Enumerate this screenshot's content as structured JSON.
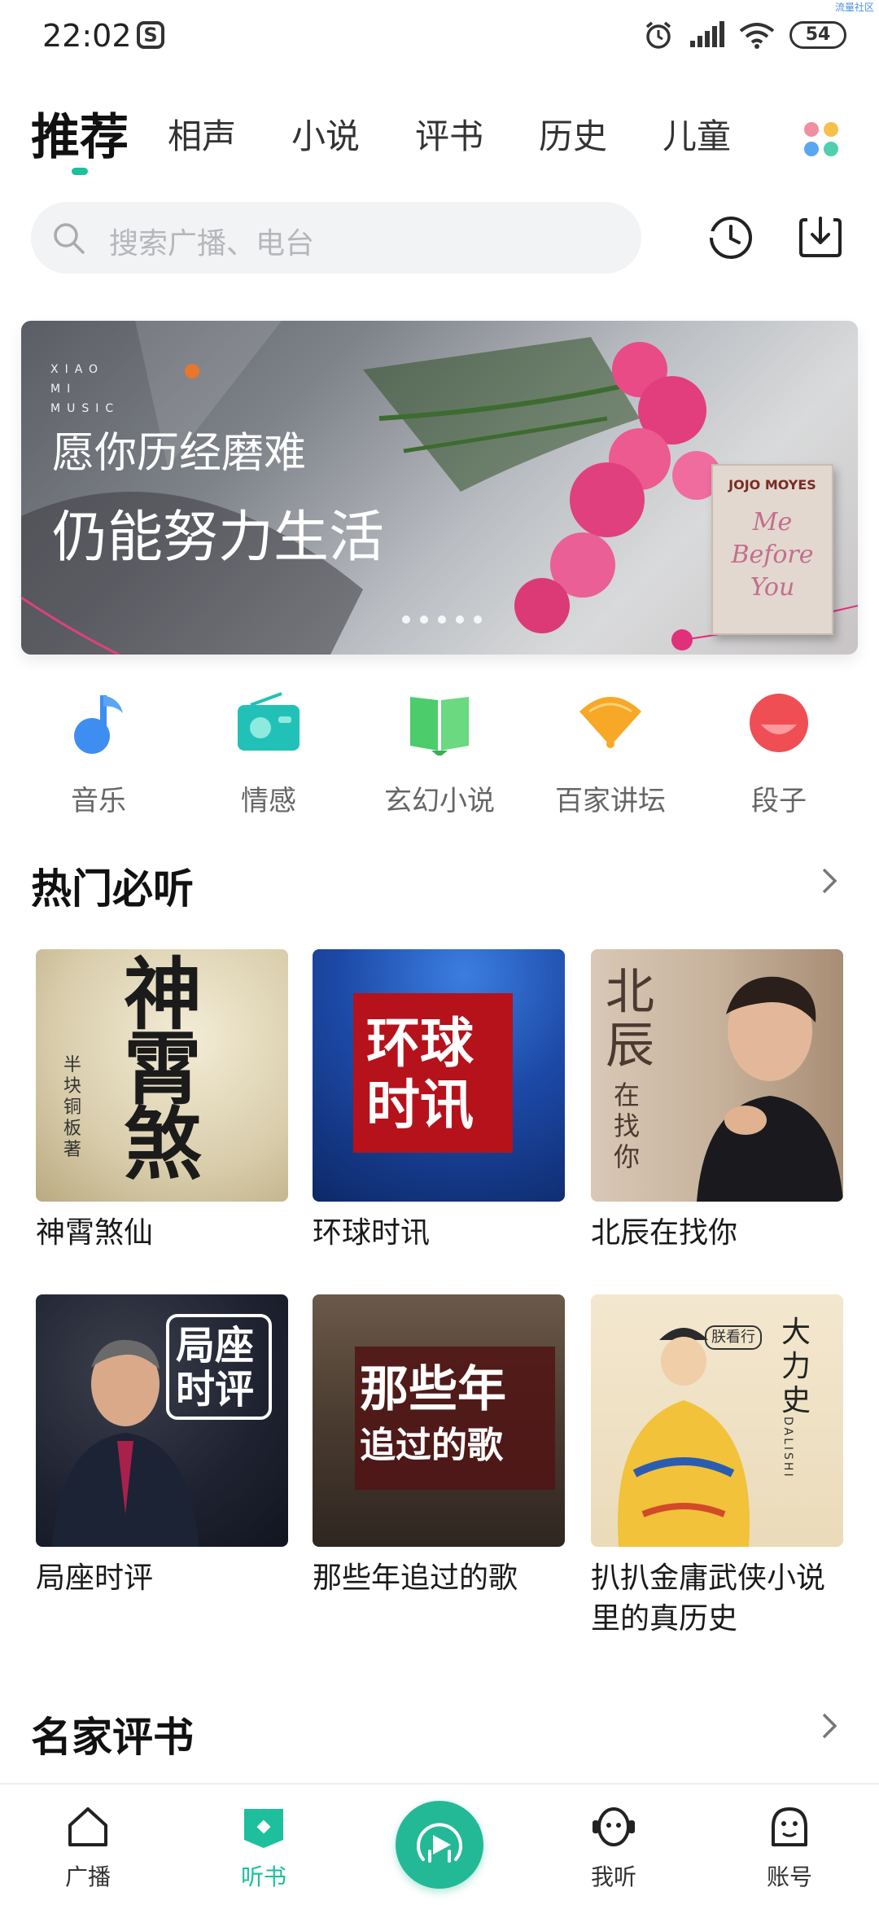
{
  "status_bar": {
    "time": "22:02",
    "carrier_badge": "S",
    "battery": "54",
    "corner_watermark": "流量社区",
    "icons": [
      "alarm-icon",
      "signal-icon",
      "wifi-icon",
      "battery-icon"
    ]
  },
  "tabs": {
    "items": [
      "推荐",
      "相声",
      "小说",
      "评书",
      "历史",
      "儿童"
    ],
    "active_index": 0
  },
  "search": {
    "placeholder": "搜索广播、电台"
  },
  "banner": {
    "brand": "XIAO MI MUSIC",
    "line1": "愿你历经磨难",
    "line2": "仍能努力生活",
    "book_author": "JOJO MOYES",
    "book_title": "Me Before You",
    "dot_count": 5
  },
  "categories": [
    {
      "label": "音乐",
      "icon": "music-note-icon",
      "color": "#3d8ef0"
    },
    {
      "label": "情感",
      "icon": "radio-icon",
      "color": "#22c1b7"
    },
    {
      "label": "玄幻小说",
      "icon": "book-icon",
      "color": "#4ccc6a"
    },
    {
      "label": "百家讲坛",
      "icon": "fan-icon",
      "color": "#f7a826"
    },
    {
      "label": "段子",
      "icon": "smile-icon",
      "color": "#f04e55"
    }
  ],
  "hot_section": {
    "title": "热门必听",
    "items": [
      {
        "title": "神霄煞仙",
        "cover_text": "神霄煞",
        "cover_sub": "半块铜板著"
      },
      {
        "title": "环球时讯",
        "cover_text": "环球时讯"
      },
      {
        "title": "北辰在找你",
        "cover_text": "北辰",
        "cover_sub": "在找你"
      },
      {
        "title": "局座时评",
        "cover_text": "局座时评"
      },
      {
        "title": "那些年追过的歌",
        "cover_text": "那些年",
        "cover_sub": "追过的歌"
      },
      {
        "title": "扒扒金庸武侠小说里的真历史",
        "cover_text": "大力史",
        "cover_sub": "DALISHI",
        "cover_badge": "朕看行"
      }
    ]
  },
  "famous_section": {
    "title": "名家评书"
  },
  "bottom_nav": {
    "items": [
      {
        "label": "广播",
        "icon": "home-icon"
      },
      {
        "label": "听书",
        "icon": "bookmark-icon"
      },
      {
        "label": "",
        "icon": "play-icon"
      },
      {
        "label": "我听",
        "icon": "headphone-face-icon"
      },
      {
        "label": "账号",
        "icon": "account-face-icon"
      }
    ],
    "active_index": 1
  },
  "colors": {
    "accent": "#1dbf9d",
    "text": "#1a1a1a",
    "muted": "#666666"
  }
}
